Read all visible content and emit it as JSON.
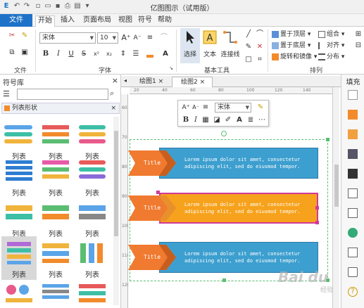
{
  "window": {
    "title": "亿图图示（试用版）"
  },
  "tabs": [
    {
      "label": "文件"
    },
    {
      "label": "开始"
    },
    {
      "label": "插入"
    },
    {
      "label": "页面布局"
    },
    {
      "label": "视图"
    },
    {
      "label": "符号"
    },
    {
      "label": "帮助"
    }
  ],
  "ribbon": {
    "font_name": "宋体",
    "font_size": "10",
    "groups": {
      "file": "文件",
      "font": "字体",
      "basic_tools": "基本工具",
      "arrange": "排列"
    },
    "tools": {
      "select": "选择",
      "text": "文本",
      "connector": "连接线"
    },
    "arrange": {
      "top": "置于顶层",
      "bottom": "置于底层",
      "rotate": "旋转和镜像",
      "group": "组合",
      "align": "对齐",
      "distribute": "分布"
    },
    "colors": {
      "accent": "#1e73c8",
      "orange": "#f28b2b"
    }
  },
  "left_panel": {
    "title": "符号库",
    "category": "列表形状",
    "shapes": [
      {
        "label": "列表"
      },
      {
        "label": "列表"
      },
      {
        "label": "列表"
      },
      {
        "label": "列表"
      },
      {
        "label": "列表"
      },
      {
        "label": "列表"
      },
      {
        "label": "列表"
      },
      {
        "label": "列表"
      },
      {
        "label": "列表"
      },
      {
        "label": "列表"
      },
      {
        "label": "列表"
      },
      {
        "label": "列表"
      }
    ]
  },
  "doc_tabs": [
    {
      "label": "绘图1"
    },
    {
      "label": "绘图2"
    }
  ],
  "rulers": {
    "h": [
      "20",
      "40",
      "60",
      "80",
      "100",
      "120",
      "140"
    ],
    "v": [
      "60",
      "70",
      "80",
      "90",
      "100",
      "110",
      "120"
    ]
  },
  "floating_toolbar": {
    "font_name": "宋体"
  },
  "canvas": {
    "rows": [
      {
        "title": "Title",
        "line1": "Lorem ipsum dolor sit amet, consectetur",
        "line2": "adipiscing elit, sed do eiusmod tempor."
      },
      {
        "title": "Title",
        "line1": "Lorem ipsum dolor sit amet, consectetur",
        "line2": "adipiscing elit, sed do eiusmod tempor."
      },
      {
        "title": "Title",
        "line1": "Lorem ipsum dolor sit amet, consectetur",
        "line2": "adipiscing elit, sed do eiusmod tempor."
      }
    ]
  },
  "right_panel": {
    "title": "填充"
  },
  "watermark": {
    "brand": "Bai du",
    "sub": "经验"
  }
}
